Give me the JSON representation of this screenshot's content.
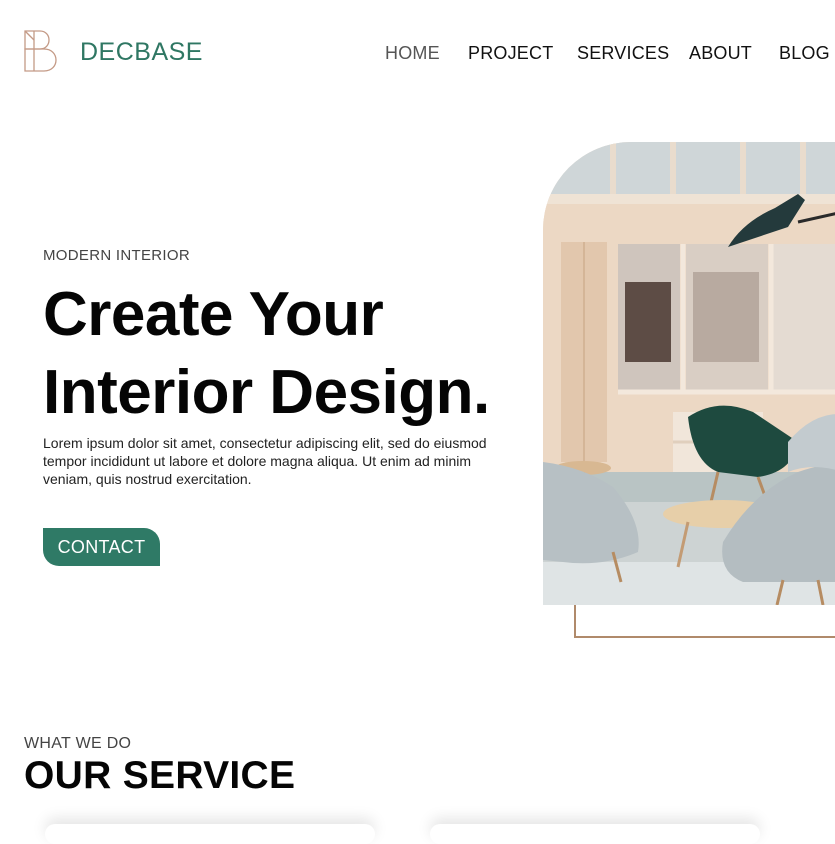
{
  "brand": {
    "name": "DECBASE",
    "logo_icon": "decbase-b-logo-icon",
    "accent": "#2f7763",
    "logo_color": "#c49a86"
  },
  "nav": {
    "items": [
      {
        "label": "HOME",
        "active": true
      },
      {
        "label": "PROJECT",
        "active": false
      },
      {
        "label": "SERVICES",
        "active": false
      },
      {
        "label": "ABOUT",
        "active": false
      },
      {
        "label": "BLOG",
        "active": false
      }
    ]
  },
  "hero": {
    "eyebrow": "MODERN INTERIOR",
    "title_line1": "Create Your",
    "title_line2": "Interior Design.",
    "body": "Lorem ipsum dolor sit amet, consectetur adipiscing elit, sed do eiusmod tempor incididunt ut labore et dolore magna aliqua. Ut enim ad minim veniam, quis nostrud exercitation.",
    "cta_label": "CONTACT",
    "cta_color": "#2f7a66",
    "frame_color": "#b08a6b"
  },
  "services": {
    "eyebrow": "WHAT WE DO",
    "title": "OUR SERVICE"
  }
}
